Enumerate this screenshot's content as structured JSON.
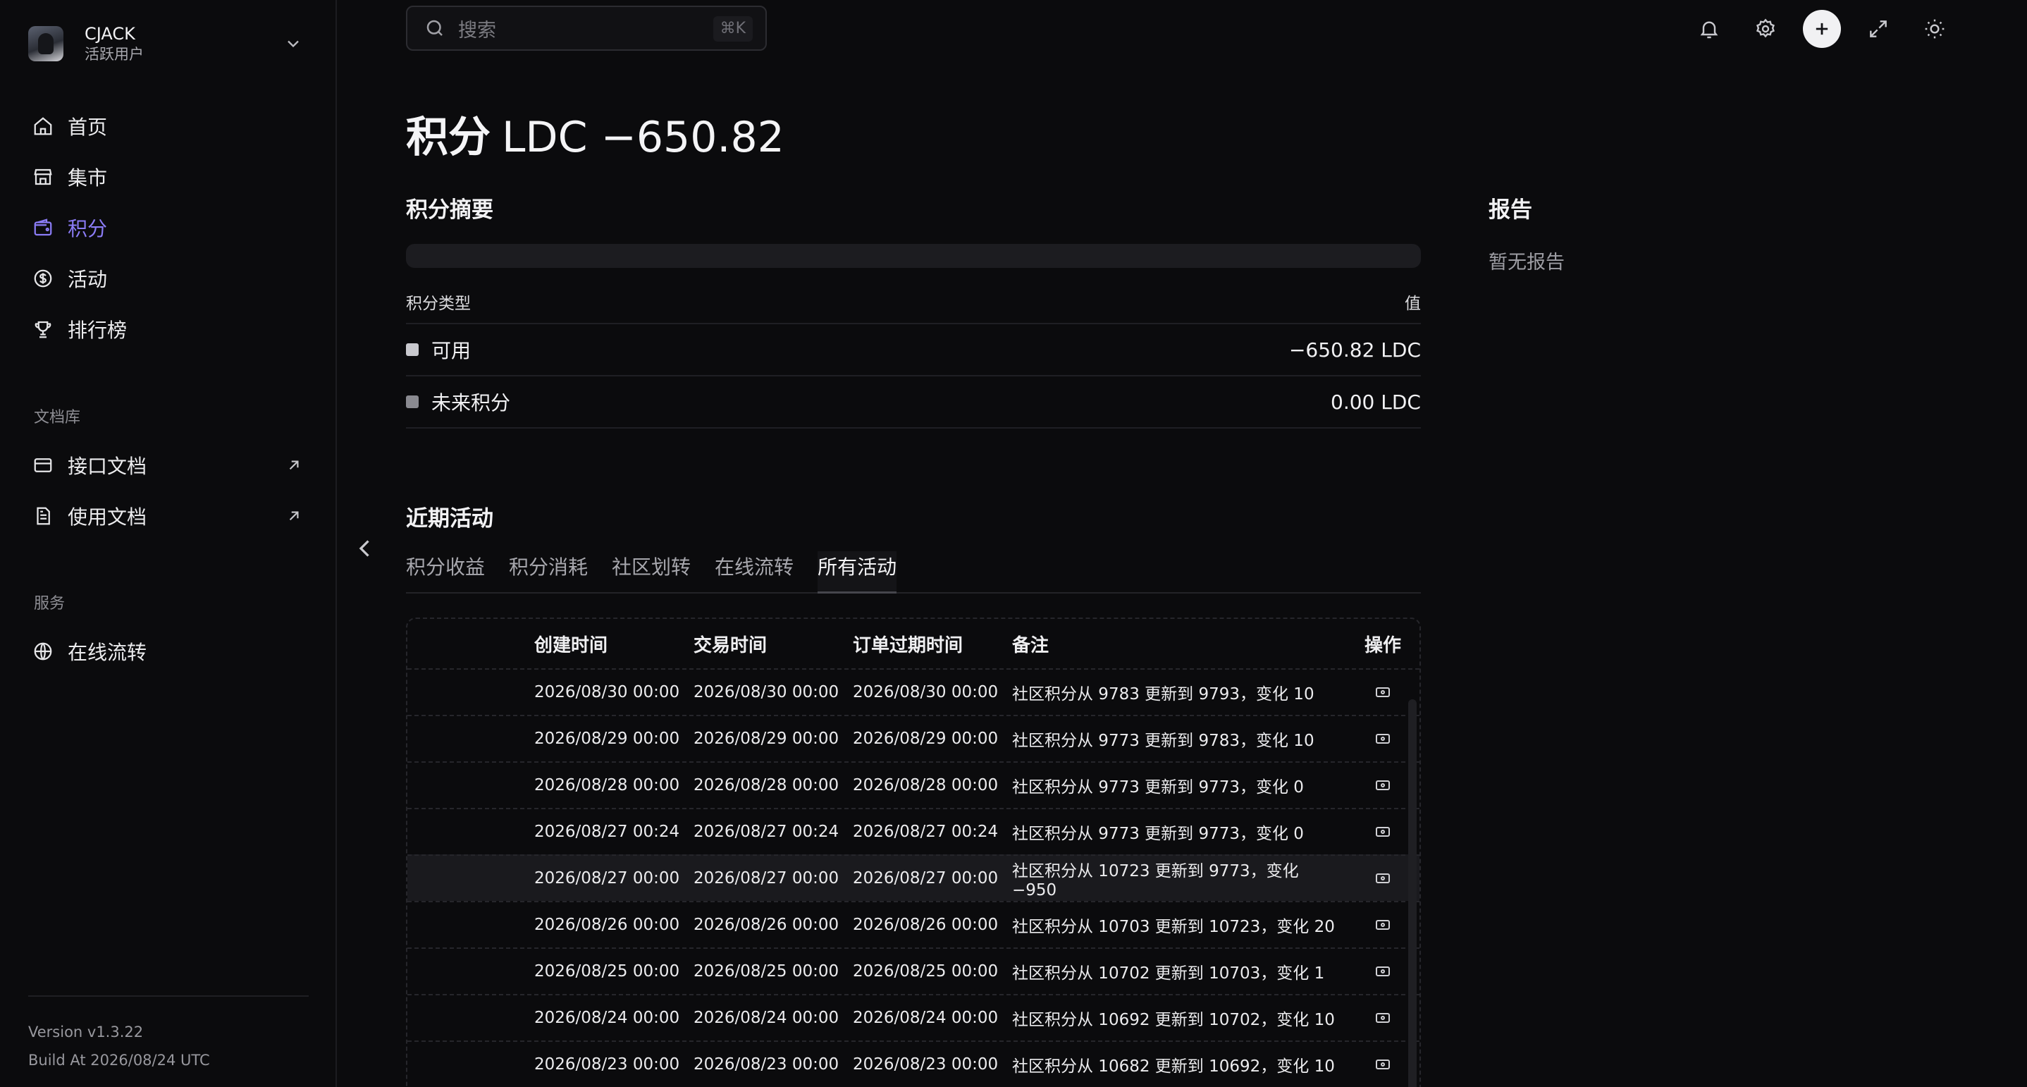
{
  "user": {
    "name": "CJACK",
    "role": "活跃用户"
  },
  "nav": [
    {
      "label": "首页",
      "icon": "home-icon"
    },
    {
      "label": "集市",
      "icon": "store-icon"
    },
    {
      "label": "积分",
      "icon": "wallet-icon",
      "active": true
    },
    {
      "label": "活动",
      "icon": "dollar-circle-icon"
    },
    {
      "label": "排行榜",
      "icon": "trophy-icon"
    }
  ],
  "docs": {
    "section_label": "文档库",
    "items": [
      {
        "label": "接口文档",
        "icon": "card-icon"
      },
      {
        "label": "使用文档",
        "icon": "document-icon"
      }
    ]
  },
  "services": {
    "section_label": "服务",
    "items": [
      {
        "label": "在线流转",
        "icon": "globe-icon"
      }
    ]
  },
  "footer": {
    "version": "Version v1.3.22",
    "build": "Build At 2026/08/24 UTC"
  },
  "search": {
    "placeholder": "搜索",
    "shortcut": "⌘K"
  },
  "page": {
    "title_cn": "积分",
    "title_amount": "LDC −650.82"
  },
  "summary": {
    "title": "积分摘要",
    "col_type": "积分类型",
    "col_value": "值",
    "rows": [
      {
        "label": "可用",
        "value": "−650.82 LDC",
        "color": "#c9c9ce"
      },
      {
        "label": "未来积分",
        "value": "0.00 LDC",
        "color": "#8a8a90"
      }
    ]
  },
  "reports": {
    "title": "报告",
    "empty": "暂无报告"
  },
  "activity": {
    "title": "近期活动",
    "tabs": [
      "积分收益",
      "积分消耗",
      "社区划转",
      "在线流转",
      "所有活动"
    ],
    "active_tab": 4,
    "columns": [
      "创建时间",
      "交易时间",
      "订单过期时间",
      "备注",
      "操作"
    ],
    "rows": [
      {
        "created": "2026/08/30 00:00",
        "trade": "2026/08/30 00:00",
        "expire": "2026/08/30 00:00",
        "note": "社区积分从 9783 更新到 9793，变化 10"
      },
      {
        "created": "2026/08/29 00:00",
        "trade": "2026/08/29 00:00",
        "expire": "2026/08/29 00:00",
        "note": "社区积分从 9773 更新到 9783，变化 10"
      },
      {
        "created": "2026/08/28 00:00",
        "trade": "2026/08/28 00:00",
        "expire": "2026/08/28 00:00",
        "note": "社区积分从 9773 更新到 9773，变化 0"
      },
      {
        "created": "2026/08/27 00:24",
        "trade": "2026/08/27 00:24",
        "expire": "2026/08/27 00:24",
        "note": "社区积分从 9773 更新到 9773，变化 0"
      },
      {
        "created": "2026/08/27 00:00",
        "trade": "2026/08/27 00:00",
        "expire": "2026/08/27 00:00",
        "note": "社区积分从 10723 更新到 9773，变化 −950",
        "highlight": true
      },
      {
        "created": "2026/08/26 00:00",
        "trade": "2026/08/26 00:00",
        "expire": "2026/08/26 00:00",
        "note": "社区积分从 10703 更新到 10723，变化 20"
      },
      {
        "created": "2026/08/25 00:00",
        "trade": "2026/08/25 00:00",
        "expire": "2026/08/25 00:00",
        "note": "社区积分从 10702 更新到 10703，变化 1"
      },
      {
        "created": "2026/08/24 00:00",
        "trade": "2026/08/24 00:00",
        "expire": "2026/08/24 00:00",
        "note": "社区积分从 10692 更新到 10702，变化 10"
      },
      {
        "created": "2026/08/23 00:00",
        "trade": "2026/08/23 00:00",
        "expire": "2026/08/23 00:00",
        "note": "社区积分从 10682 更新到 10692，变化 10"
      }
    ]
  },
  "colors": {
    "accent": "#8b7cf6",
    "background": "#0b0b0d"
  }
}
